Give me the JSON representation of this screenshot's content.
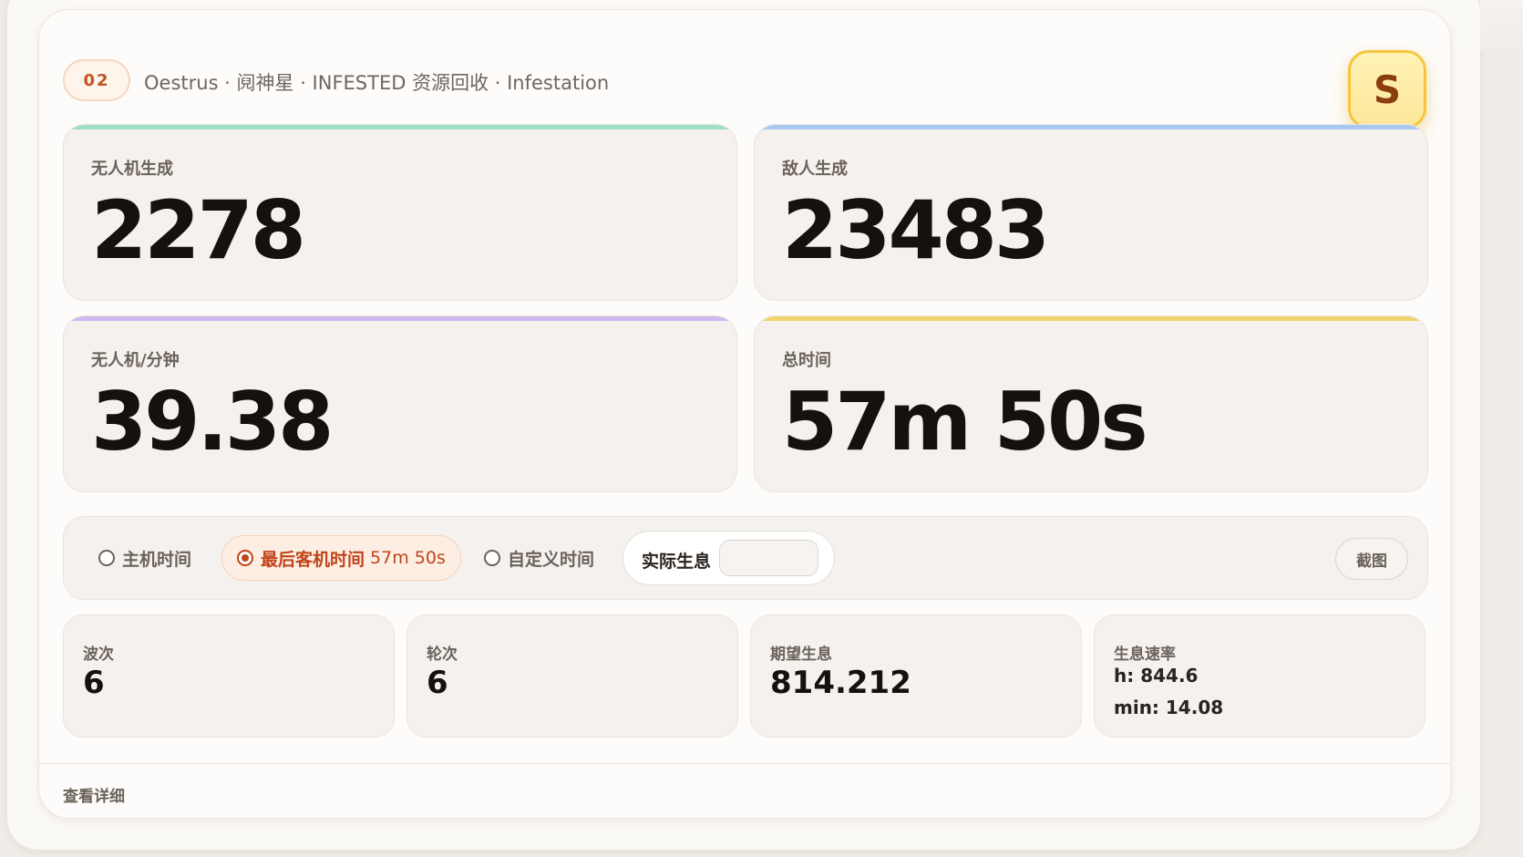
{
  "header": {
    "number": "02",
    "mission": "Oestrus · 阋神星 · INFESTED 资源回收 · Infestation",
    "rank": "S"
  },
  "stats": {
    "drone_spawn": {
      "label": "无人机生成",
      "value": "2278",
      "accent": "#9fe0c4"
    },
    "enemy_spawn": {
      "label": "敌人生成",
      "value": "23483",
      "accent": "#a9c8f0"
    },
    "drones_per_min": {
      "label": "无人机/分钟",
      "value": "39.38",
      "accent": "#cdb8ef"
    },
    "total_time": {
      "label": "总时间",
      "value": "57m 50s",
      "accent": "#f2d36b"
    }
  },
  "controls": {
    "host_time": "主机时间",
    "last_client_time": "最后客机时间",
    "last_client_time_value": "57m 50s",
    "custom_time": "自定义时间",
    "actual_life_support": "实际生息",
    "actual_life_support_value": "",
    "screenshot": "截图",
    "selected": "last_client_time"
  },
  "small_stats": {
    "waves": {
      "label": "波次",
      "value": "6"
    },
    "rounds": {
      "label": "轮次",
      "value": "6"
    },
    "expected_life_support": {
      "label": "期望生息",
      "value": "814.212"
    },
    "life_support_rate": {
      "label": "生息速率",
      "h": "h: 844.6",
      "min": "min: 14.08"
    }
  },
  "footer": {
    "details": "查看详细"
  },
  "colors": {
    "accent": "#c0441a",
    "rank_gold": "#f4c53e"
  }
}
